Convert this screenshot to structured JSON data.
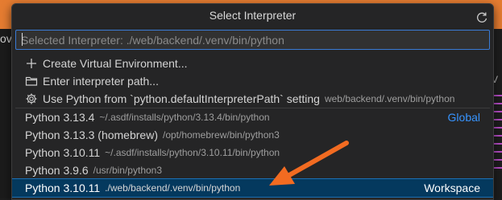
{
  "dialog": {
    "title": "Select Interpreter",
    "search": {
      "value": "",
      "placeholder": "Selected Interpreter: ./web/backend/.venv/bin/python"
    }
  },
  "background": {
    "left_text": "ov",
    "right_text": "V"
  },
  "actions": [
    {
      "icon": "plus-icon",
      "label": "Create Virtual Environment..."
    },
    {
      "icon": "folder-icon",
      "label": "Enter interpreter path..."
    },
    {
      "icon": "gear-icon",
      "label": "Use Python from `python.defaultInterpreterPath` setting",
      "description": "web/backend/.venv/bin/python"
    }
  ],
  "interpreters": [
    {
      "label": "Python 3.13.4",
      "path": "~/.asdf/installs/python/3.13.4/bin/python",
      "badge": "Global"
    },
    {
      "label": "Python 3.13.3 (homebrew)",
      "path": "/opt/homebrew/bin/python3",
      "badge": ""
    },
    {
      "label": "Python 3.10.11",
      "path": "~/.asdf/installs/python/3.10.11/bin/python",
      "badge": ""
    },
    {
      "label": "Python 3.9.6",
      "path": "/usr/bin/python3",
      "badge": ""
    },
    {
      "label": "Python 3.10.11",
      "path": "./web/backend/.venv/bin/python",
      "badge": "Workspace",
      "selected": true
    }
  ],
  "colors": {
    "accent": "#3794ff",
    "selection": "#04395e",
    "annotation_arrow": "#f26b21",
    "window_bar": "#e57c31"
  }
}
